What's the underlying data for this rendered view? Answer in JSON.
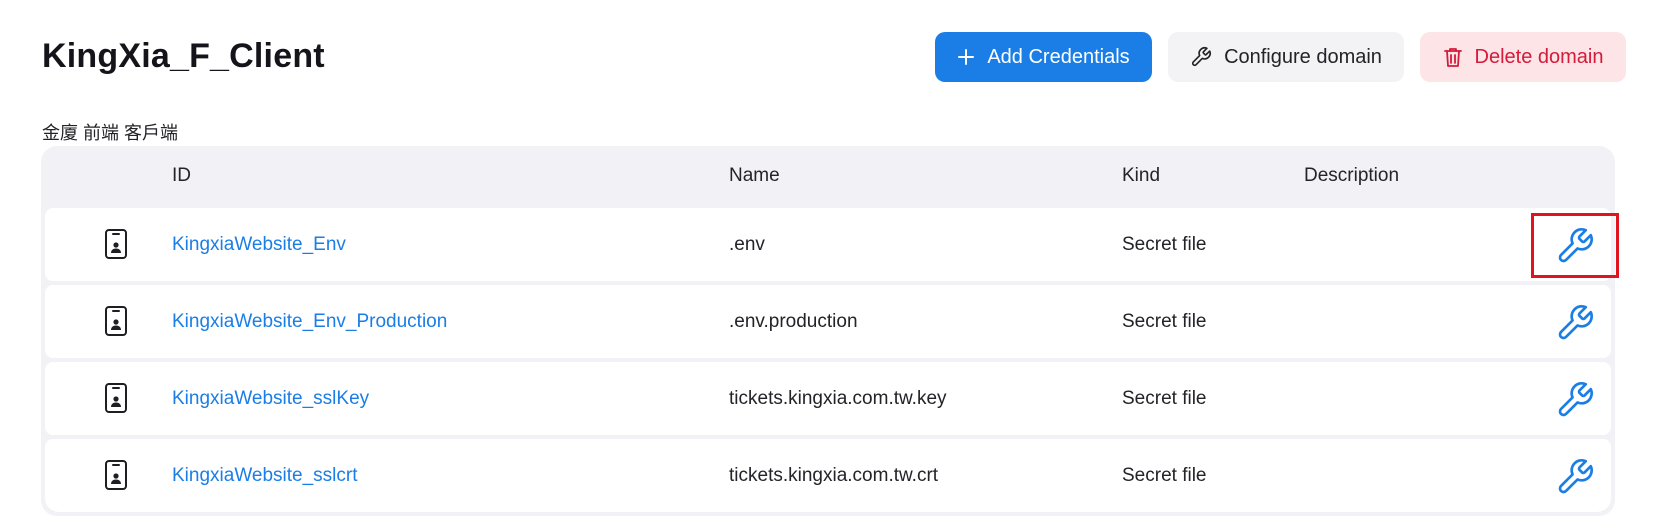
{
  "header": {
    "title": "KingXia_F_Client",
    "subtitle": "金廈 前端 客戶端"
  },
  "actions": {
    "add_credentials": "Add Credentials",
    "configure_domain": "Configure domain",
    "delete_domain": "Delete domain"
  },
  "table": {
    "columns": {
      "id": "ID",
      "name": "Name",
      "kind": "Kind",
      "description": "Description"
    },
    "rows": [
      {
        "id": "KingxiaWebsite_Env",
        "name": ".env",
        "kind": "Secret file",
        "description": "",
        "icon": "phone-id-icon",
        "action_icon": "wrench-icon"
      },
      {
        "id": "KingxiaWebsite_Env_Production",
        "name": ".env.production",
        "kind": "Secret file",
        "description": "",
        "icon": "phone-id-icon",
        "action_icon": "wrench-icon"
      },
      {
        "id": "KingxiaWebsite_sslKey",
        "name": "tickets.kingxia.com.tw.key",
        "kind": "Secret file",
        "description": "",
        "icon": "phone-id-icon",
        "action_icon": "wrench-icon"
      },
      {
        "id": "KingxiaWebsite_sslcrt",
        "name": "tickets.kingxia.com.tw.crt",
        "kind": "Secret file",
        "description": "",
        "icon": "phone-id-icon",
        "action_icon": "wrench-icon"
      }
    ]
  },
  "colors": {
    "accent": "#1a7ee6",
    "danger": "#d31b3a",
    "danger_bg": "#fde4e7",
    "highlight": "#e0141e"
  }
}
